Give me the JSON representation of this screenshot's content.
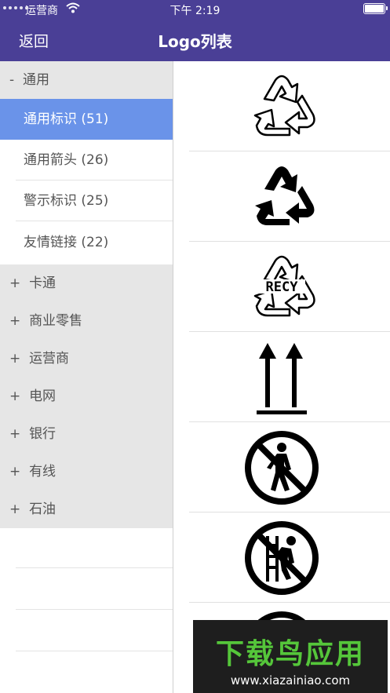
{
  "status_bar": {
    "carrier": "运营商",
    "time": "下午 2:19"
  },
  "nav": {
    "back_label": "返回",
    "title": "Logo列表"
  },
  "sidebar": {
    "groups": [
      {
        "sign": "-",
        "label": "通用",
        "expanded": true,
        "items": [
          {
            "label": "通用标识 (51)",
            "selected": true
          },
          {
            "label": "通用箭头 (26)"
          },
          {
            "label": "警示标识 (25)"
          },
          {
            "label": "友情链接 (22)"
          }
        ]
      },
      {
        "sign": "+",
        "label": "卡通"
      },
      {
        "sign": "+",
        "label": "商业零售"
      },
      {
        "sign": "+",
        "label": "运营商"
      },
      {
        "sign": "+",
        "label": "电网"
      },
      {
        "sign": "+",
        "label": "银行"
      },
      {
        "sign": "+",
        "label": "有线"
      },
      {
        "sign": "+",
        "label": "石油"
      }
    ]
  },
  "logos": [
    {
      "icon": "recycle-outline-icon"
    },
    {
      "icon": "recycle-solid-icon"
    },
    {
      "icon": "recycle-recy-icon",
      "text": "RECY"
    },
    {
      "icon": "this-way-up-arrows-icon"
    },
    {
      "icon": "no-pedestrian-icon"
    },
    {
      "icon": "no-climbing-icon"
    }
  ],
  "watermark": {
    "title": "下载鸟应用",
    "url": "www.xiazainiao.com"
  },
  "colors": {
    "nav": "#4a3f96",
    "selected": "#6a93e9",
    "group_bg": "#e6e6e6",
    "watermark_green": "#55c63a"
  }
}
